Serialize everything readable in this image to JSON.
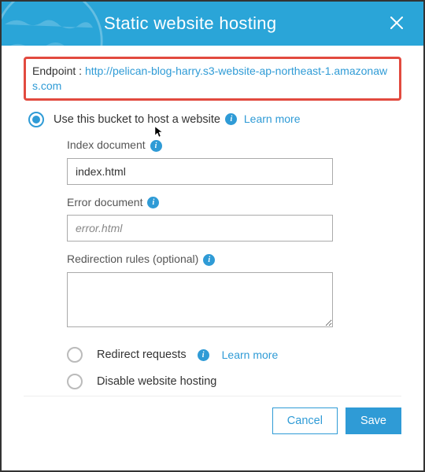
{
  "header": {
    "title": "Static website hosting"
  },
  "endpoint": {
    "label": "Endpoint : ",
    "url": "http://pelican-blog-harry.s3-website-ap-northeast-1.amazonaws.com"
  },
  "options": {
    "host": {
      "label": "Use this bucket to host a website",
      "learn_more": "Learn more"
    },
    "redirect": {
      "label": "Redirect requests",
      "learn_more": "Learn more"
    },
    "disable": {
      "label": "Disable website hosting"
    }
  },
  "fields": {
    "index_doc": {
      "label": "Index document",
      "value": "index.html"
    },
    "error_doc": {
      "label": "Error document",
      "placeholder": "error.html"
    },
    "redirection": {
      "label": "Redirection rules (optional)"
    }
  },
  "footer": {
    "cancel": "Cancel",
    "save": "Save"
  }
}
